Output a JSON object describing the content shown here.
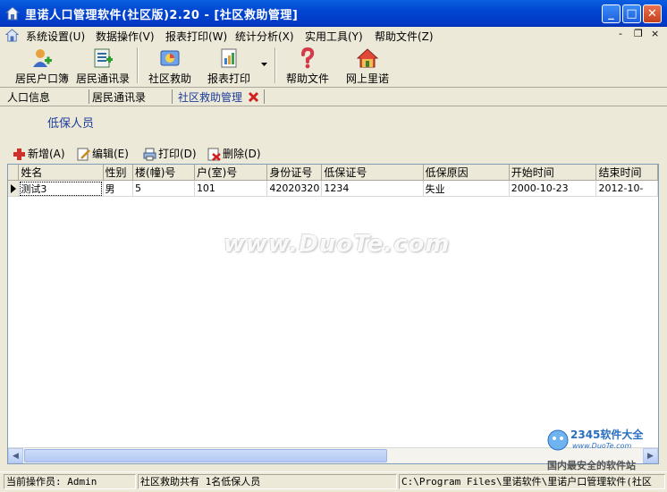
{
  "window": {
    "title": "里诺人口管理软件(社区版)2.20 - [社区救助管理]",
    "controls": {
      "minimize": "_",
      "maximize": "□",
      "close": "✕"
    }
  },
  "menu": {
    "items": [
      {
        "label": "系统设置(U)"
      },
      {
        "label": "数据操作(V)"
      },
      {
        "label": "报表打印(W)"
      },
      {
        "label": "统计分析(X)"
      },
      {
        "label": "实用工具(Y)"
      },
      {
        "label": "帮助文件(Z)"
      }
    ],
    "mdi": {
      "minimize": "-",
      "restore": "❐",
      "close": "×"
    }
  },
  "toolbar": {
    "buttons": [
      {
        "label": "居民户口簿",
        "icon": "user-add-icon"
      },
      {
        "label": "居民通讯录",
        "icon": "contacts-icon"
      },
      {
        "label": "社区救助",
        "icon": "aid-icon"
      },
      {
        "label": "报表打印",
        "icon": "report-icon"
      },
      {
        "label": "帮助文件",
        "icon": "help-icon"
      },
      {
        "label": "网上里诺",
        "icon": "home-icon"
      }
    ]
  },
  "tabs": [
    {
      "label": "人口信息"
    },
    {
      "label": "居民通讯录"
    },
    {
      "label": "社区救助管理",
      "active": true
    }
  ],
  "panel": {
    "title": "低保人员"
  },
  "actions": [
    {
      "label": "新增(A)",
      "icon": "add-icon"
    },
    {
      "label": "编辑(E)",
      "icon": "edit-icon"
    },
    {
      "label": "打印(D)",
      "icon": "print-icon"
    },
    {
      "label": "删除(D)",
      "icon": "delete-icon"
    }
  ],
  "grid": {
    "columns": [
      "姓名",
      "性别",
      "楼(幢)号",
      "户(室)号",
      "身份证号",
      "低保证号",
      "低保原因",
      "开始时间",
      "结束时间"
    ],
    "rows": [
      [
        "测试3",
        "男",
        "5",
        "101",
        "42020320",
        "1234",
        "失业",
        "2000-10-23",
        "2012-10-"
      ]
    ]
  },
  "watermark": "www.DuoTe.com",
  "brand": {
    "name": "2345软件大全",
    "url": "www.DuoTe.com",
    "tagline": "国内最安全的软件站"
  },
  "status": {
    "operator": "当前操作员: Admin",
    "summary": "社区救助共有 1名低保人员",
    "path": "C:\\Program Files\\里诺软件\\里诺户口管理软件(社区"
  }
}
